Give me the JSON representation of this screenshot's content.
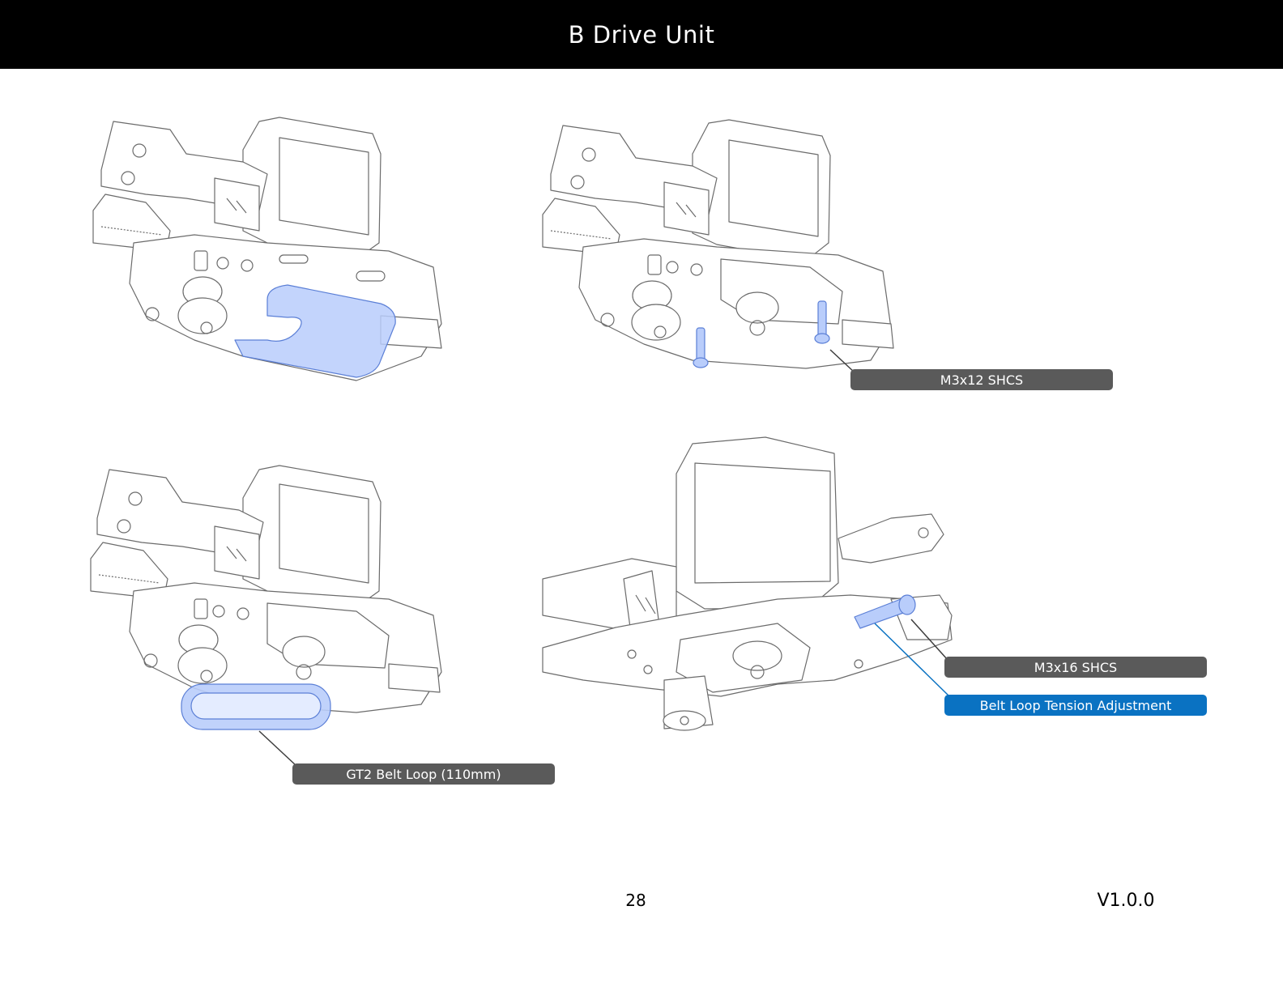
{
  "header": {
    "title": "B Drive Unit"
  },
  "callouts": {
    "m3x12": "M3x12 SHCS",
    "gt2_belt": "GT2 Belt Loop (110mm)",
    "m3x16": "M3x16 SHCS",
    "belt_tension": "Belt Loop Tension Adjustment"
  },
  "footer": {
    "page_number": "28",
    "version": "V1.0.0"
  },
  "colors": {
    "header_bg": "#000000",
    "callout_gray": "#5a5a5a",
    "callout_blue": "#0a72c2",
    "highlight_part": "#b9cdfb"
  }
}
